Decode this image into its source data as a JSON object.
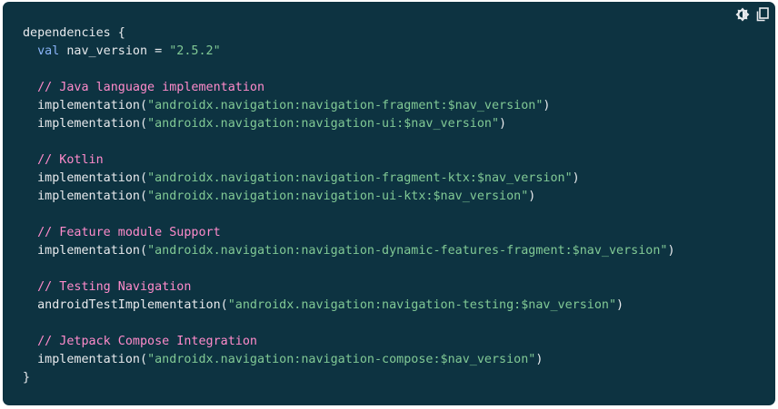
{
  "toolbar": {
    "theme_icon": "brightness-icon",
    "copy_icon": "copy-icon"
  },
  "colors": {
    "background": "#0d3341",
    "text": "#e8eaed",
    "keyword": "#8ab4f8",
    "string": "#81c995",
    "comment": "#ff8bcb"
  },
  "code": {
    "l1": "dependencies {",
    "l2_kw": "val",
    "l2_rest": " nav_version = ",
    "l2_str": "\"2.5.2\"",
    "c1": "// Java language implementation",
    "l5_fn": "implementation(",
    "l5_str": "\"androidx.navigation:navigation-fragment:$nav_version\"",
    "l5_end": ")",
    "l6_fn": "implementation(",
    "l6_str": "\"androidx.navigation:navigation-ui:$nav_version\"",
    "l6_end": ")",
    "c2": "// Kotlin",
    "l9_fn": "implementation(",
    "l9_str": "\"androidx.navigation:navigation-fragment-ktx:$nav_version\"",
    "l9_end": ")",
    "l10_fn": "implementation(",
    "l10_str": "\"androidx.navigation:navigation-ui-ktx:$nav_version\"",
    "l10_end": ")",
    "c3": "// Feature module Support",
    "l13_fn": "implementation(",
    "l13_str": "\"androidx.navigation:navigation-dynamic-features-fragment:$nav_version\"",
    "l13_end": ")",
    "c4": "// Testing Navigation",
    "l16_fn": "androidTestImplementation(",
    "l16_str": "\"androidx.navigation:navigation-testing:$nav_version\"",
    "l16_end": ")",
    "c5": "// Jetpack Compose Integration",
    "l19_fn": "implementation(",
    "l19_str": "\"androidx.navigation:navigation-compose:$nav_version\"",
    "l19_end": ")",
    "l20": "}"
  }
}
